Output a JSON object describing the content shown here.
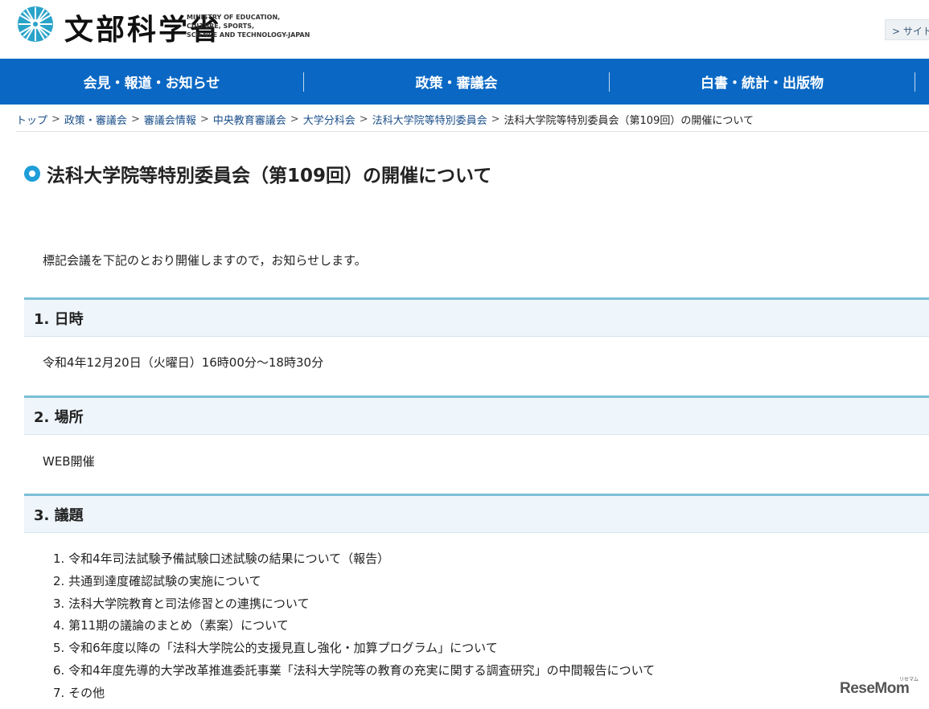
{
  "header": {
    "logo_ja": "文部科学省",
    "logo_en_lines": [
      "MINISTRY OF EDUCATION,",
      "CULTURE, SPORTS,",
      "SCIENCE AND TECHNOLOGY-JAPAN"
    ],
    "sitemap_label": "> サイト"
  },
  "gnav": {
    "items": [
      {
        "label": "会見・報道・お知らせ"
      },
      {
        "label": "政策・審議会"
      },
      {
        "label": "白書・統計・出版物"
      }
    ]
  },
  "breadcrumb": {
    "links": [
      "トップ",
      "政策・審議会",
      "審議会情報",
      "中央教育審議会",
      "大学分科会",
      "法科大学院等特別委員会"
    ],
    "separator": ">",
    "current": "法科大学院等特別委員会（第109回）の開催について"
  },
  "page": {
    "title": "法科大学院等特別委員会（第109回）の開催について",
    "intro": "標記会議を下記のとおり開催しますので，お知らせします。"
  },
  "sections": [
    {
      "heading": "1. 日時",
      "body": "令和4年12月20日（火曜日）16時00分～18時30分"
    },
    {
      "heading": "2. 場所",
      "body": "WEB開催"
    },
    {
      "heading": "3. 議題",
      "body": ""
    }
  ],
  "agenda": [
    "1. 令和4年司法試験予備試験口述試験の結果について（報告）",
    "2. 共通到達度確認試験の実施について",
    "3. 法科大学院教育と司法修習との連携について",
    "4. 第11期の議論のまとめ（素案）について",
    "5. 令和6年度以降の「法科大学院公的支援見直し強化・加算プログラム」について",
    "6. 令和4年度先導的大学改革推進委託事業「法科大学院等の教育の充実に関する調査研究」の中間報告について",
    "7. その他"
  ],
  "watermark": {
    "text": "ReseMom",
    "sub": "リセマム"
  },
  "colors": {
    "nav": "#0a68c4",
    "accent": "#1e9ed8",
    "section_border": "#7bbfd8",
    "section_bg": "#eef5fb"
  }
}
